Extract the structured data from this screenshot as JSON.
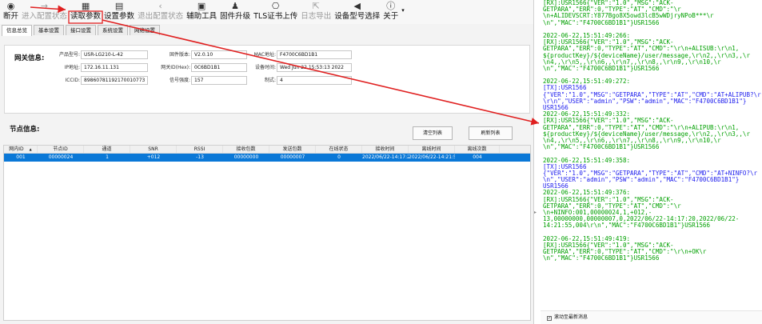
{
  "toolbar": {
    "items": [
      {
        "label": "断开",
        "icon": "◉",
        "disabled": false
      },
      {
        "label": "进入配置状态",
        "icon": "→",
        "disabled": true
      },
      {
        "label": "读取参数",
        "icon": "▦",
        "disabled": false
      },
      {
        "label": "设置参数",
        "icon": "▤",
        "disabled": false
      },
      {
        "label": "退出配置状态",
        "icon": "‹",
        "disabled": true
      },
      {
        "label": "辅助工具",
        "icon": "▣",
        "disabled": false
      },
      {
        "label": "固件升级",
        "icon": "♟",
        "disabled": false
      },
      {
        "label": "TLS证书上传",
        "icon": "⎔",
        "disabled": false
      },
      {
        "label": "日志导出",
        "icon": "⇱",
        "disabled": true
      },
      {
        "label": "设备型号选择",
        "icon": "◀",
        "disabled": false
      },
      {
        "label": "关于",
        "icon": "ⓘ",
        "disabled": false
      }
    ],
    "overflow": "▾"
  },
  "tabs": [
    "信息总览",
    "基本设置",
    "接口设置",
    "系统设置",
    "网络设置"
  ],
  "network_info": {
    "title": "网关信息:",
    "product_model_label": "产品型号:",
    "product_model": "USR-LG210-L-42",
    "firmware_label": "固件版本:",
    "firmware": "V2.0.10",
    "mac_label": "MAC地址:",
    "mac": "F4700C6BD1B1",
    "ip_label": "IP地址:",
    "ip": "172.16.11.131",
    "netid_label": "网关ID(Hex):",
    "netid": "0C6BD1B1",
    "devtime_label": "设备时间:",
    "devtime": "Wed Jun 22 15:53:13 2022",
    "iccid_label": "ICCID:",
    "iccid": "89860781192170010773",
    "signal_label": "信号强度:",
    "signal": "157",
    "mode_label": "制式:",
    "mode": "4"
  },
  "node_info": {
    "title": "节点信息:",
    "clear_button": "清空列表",
    "refresh_button": "刷新列表",
    "columns": [
      "网内ID",
      "节点ID",
      "通道",
      "SNR",
      "RSSI",
      "接收包数",
      "发送包数",
      "在线状态",
      "接收时间",
      "离线时间",
      "离线次数"
    ],
    "sort_indicator": "▲",
    "rows": [
      [
        "001",
        "00000024",
        "1",
        "+012",
        "-13",
        "00000000",
        "00000007",
        "0",
        "2022/06/22-14:17:20",
        "2022/06/22-14:21:55",
        "004"
      ]
    ]
  },
  "log": {
    "lines": [
      {
        "t": "[RX]:USR1566{\"VER\":\"1.0\",\"MSG\":\"ACK-",
        "c": "rx"
      },
      {
        "t": "GETPARA\",\"ERR\":0,\"TYPE\":\"AT\",\"CMD\":\"\\r",
        "c": "rx"
      },
      {
        "t": "\\n+ALIDEVSCRT:Y877Bgo8X5owd3lcB5wWDjryNPoB***\\r",
        "c": "rx"
      },
      {
        "t": "\\n\",\"MAC\":\"F4700C6BD1B1\"}USR1566",
        "c": "rx"
      },
      {
        "t": "",
        "c": "rx"
      },
      {
        "t": "2022-06-22,15:51:49:266:",
        "c": "rx"
      },
      {
        "t": "[RX]:USR1566{\"VER\":\"1.0\",\"MSG\":\"ACK-",
        "c": "rx"
      },
      {
        "t": "GETPARA\",\"ERR\":0,\"TYPE\":\"AT\",\"CMD\":\"\\r\\n+ALISUB:\\r\\n1,",
        "c": "rx"
      },
      {
        "t": "${productKey}/${deviceName}/user/message,\\r\\n2,,\\r\\n3,,\\r",
        "c": "rx"
      },
      {
        "t": "\\n4,,\\r\\n5,,\\r\\n6,,\\r\\n7,,\\r\\n8,,\\r\\n9,,\\r\\n10,\\r",
        "c": "rx"
      },
      {
        "t": "\\n\",\"MAC\":\"F4700C6BD1B1\"}USR1566",
        "c": "rx"
      },
      {
        "t": "",
        "c": "rx"
      },
      {
        "t": "2022-06-22,15:51:49:272:",
        "c": "rx"
      },
      {
        "t": "[TX]:USR1566",
        "c": "tx"
      },
      {
        "t": "{\"VER\":\"1.0\",\"MSG\":\"GETPARA\",\"TYPE\":\"AT\",\"CMD\":\"AT+ALIPUB?\\r",
        "c": "tx"
      },
      {
        "t": "\\r\\n\",\"USER\":\"admin\",\"PSW\":\"admin\",\"MAC\":\"F4700C6BD1B1\"}",
        "c": "tx"
      },
      {
        "t": "USR1566",
        "c": "tx"
      },
      {
        "t": "2022-06-22,15:51:49:332:",
        "c": "rx"
      },
      {
        "t": "[RX]:USR1566{\"VER\":\"1.0\",\"MSG\":\"ACK-",
        "c": "rx"
      },
      {
        "t": "GETPARA\",\"ERR\":0,\"TYPE\":\"AT\",\"CMD\":\"\\r\\n+ALIPUB:\\r\\n1,",
        "c": "rx"
      },
      {
        "t": "${productKey}/${deviceName}/user/message,\\r\\n2,,\\r\\n3,,\\r",
        "c": "rx"
      },
      {
        "t": "\\n4,,\\r\\n5,,\\r\\n6,,\\r\\n7,,\\r\\n8,,\\r\\n9,,\\r\\n10,\\r",
        "c": "rx"
      },
      {
        "t": "\\n\",\"MAC\":\"F4700C6BD1B1\"}USR1566",
        "c": "rx"
      },
      {
        "t": "",
        "c": "rx"
      },
      {
        "t": "2022-06-22,15:51:49:358:",
        "c": "rx"
      },
      {
        "t": "[TX]:USR1566",
        "c": "tx"
      },
      {
        "t": "{\"VER\":\"1.0\",\"MSG\":\"GETPARA\",\"TYPE\":\"AT\",\"CMD\":\"AT+NINFO?\\r",
        "c": "tx"
      },
      {
        "t": "\\n\",\"USER\":\"admin\",\"PSW\":\"admin\",\"MAC\":\"F4700C6BD1B1\"}",
        "c": "tx"
      },
      {
        "t": "USR1566",
        "c": "tx"
      },
      {
        "t": "2022-06-22,15:51:49:376:",
        "c": "rx"
      },
      {
        "t": "[RX]:USR1566{\"VER\":\"1.0\",\"MSG\":\"ACK-",
        "c": "rx"
      },
      {
        "t": "GETPARA\",\"ERR\":0,\"TYPE\":\"AT\",\"CMD\":\"\\r",
        "c": "rx"
      },
      {
        "t": "\\n+NINFO:001,00000024,1,+012,-",
        "c": "rx"
      },
      {
        "t": "13,00000000,00000007,0,2022/06/22-14:17:20,2022/06/22-",
        "c": "rx"
      },
      {
        "t": "14:21:55,004\\r\\n\",\"MAC\":\"F4700C6BD1B1\"}USR1566",
        "c": "rx"
      },
      {
        "t": "",
        "c": "rx"
      },
      {
        "t": "2022-06-22,15:51:49:419:",
        "c": "rx"
      },
      {
        "t": "[RX]:USR1566{\"VER\":\"1.0\",\"MSG\":\"ACK-",
        "c": "rx"
      },
      {
        "t": "GETPARA\",\"ERR\":0,\"TYPE\":\"AT\",\"CMD\":\"\\r\\n+OK\\r",
        "c": "rx"
      },
      {
        "t": "\\n\",\"MAC\":\"F4700C6BD1B1\"}USR1566",
        "c": "rx"
      }
    ],
    "autoscroll_label": "滚动至最新消息",
    "autoscroll_checked": true,
    "rx_color": "#00a000",
    "tx_color": "#1a1aee"
  },
  "colors": {
    "selection": "#0a78d7",
    "annotation": "#e02020"
  }
}
